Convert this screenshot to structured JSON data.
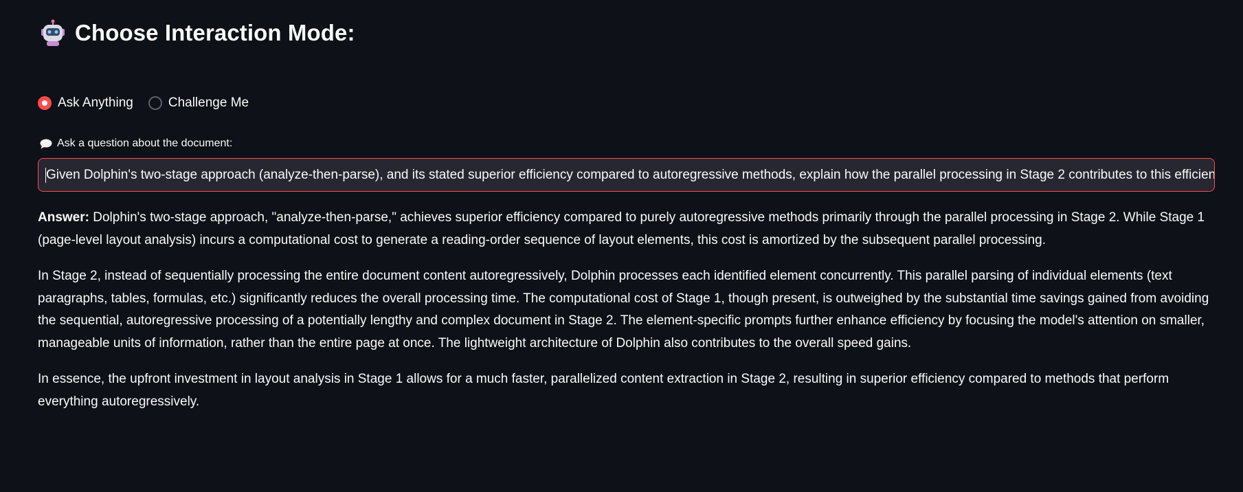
{
  "header": {
    "icon": "robot-icon",
    "title": "Choose Interaction Mode:"
  },
  "mode_selector": {
    "options": [
      {
        "label": "Ask Anything",
        "selected": true
      },
      {
        "label": "Challenge Me",
        "selected": false
      }
    ]
  },
  "question": {
    "icon": "speech-bubble-icon",
    "label": "Ask a question about the document:",
    "value": "Given Dolphin's two-stage approach (analyze-then-parse), and its stated superior efficiency compared to autoregressive methods, explain how the parallel processing in Stage 2 contributes to this efficiency"
  },
  "answer": {
    "label": "Answer:",
    "paragraphs": [
      "Dolphin's two-stage approach, \"analyze-then-parse,\" achieves superior efficiency compared to purely autoregressive methods primarily through the parallel processing in Stage 2. While Stage 1 (page-level layout analysis) incurs a computational cost to generate a reading-order sequence of layout elements, this cost is amortized by the subsequent parallel processing.",
      "In Stage 2, instead of sequentially processing the entire document content autoregressively, Dolphin processes each identified element concurrently. This parallel parsing of individual elements (text paragraphs, tables, formulas, etc.) significantly reduces the overall processing time. The computational cost of Stage 1, though present, is outweighed by the substantial time savings gained from avoiding the sequential, autoregressive processing of a potentially lengthy and complex document in Stage 2. The element-specific prompts further enhance efficiency by focusing the model's attention on smaller, manageable units of information, rather than the entire page at once. The lightweight architecture of Dolphin also contributes to the overall speed gains.",
      "In essence, the upfront investment in layout analysis in Stage 1 allows for a much faster, parallelized content extraction in Stage 2, resulting in superior efficiency compared to methods that perform everything autoregressively."
    ]
  },
  "colors": {
    "background": "#0e1117",
    "accent": "#ff4b4b",
    "text": "#fafafa",
    "input_background": "#262730"
  }
}
